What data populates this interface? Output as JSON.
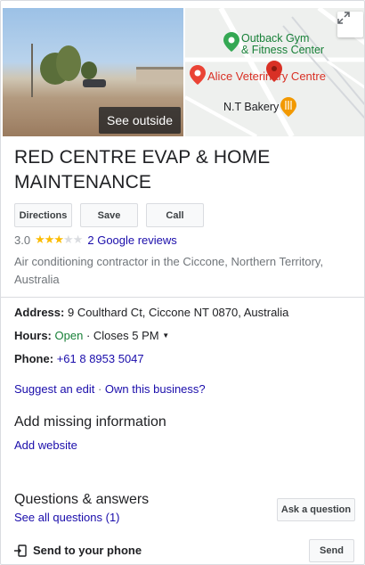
{
  "photo": {
    "see_outside_label": "See outside"
  },
  "map": {
    "labels": {
      "gym": "Outback Gym\n& Fitness Center",
      "vet": "Alice Veterinary Centre",
      "bakery": "N.T Bakery"
    },
    "expand_icon": "expand-icon"
  },
  "business": {
    "name": "RED CENTRE EVAP & HOME MAINTENANCE",
    "rating_value": "3.0",
    "rating_stars": 3,
    "reviews_label": "2 Google reviews",
    "category": "Air conditioning contractor in the Ciccone, Northern Territory, Australia"
  },
  "actions": {
    "directions": "Directions",
    "save": "Save",
    "call": "Call"
  },
  "details": {
    "address_label": "Address:",
    "address_value": "9 Coulthard Ct, Ciccone NT 0870, Australia",
    "hours_label": "Hours:",
    "hours_status": "Open",
    "hours_sep": " · ",
    "hours_closes": "Closes 5 PM",
    "phone_label": "Phone:",
    "phone_value": "+61 8 8953 5047"
  },
  "links": {
    "suggest_edit": "Suggest an edit",
    "sep": " · ",
    "own_business": "Own this business?"
  },
  "missing": {
    "heading": "Add missing information",
    "add_website": "Add website"
  },
  "qa": {
    "heading": "Questions & answers",
    "see_all": "See all questions (1)",
    "ask_button": "Ask a question"
  },
  "send": {
    "label": "Send to your phone",
    "button": "Send"
  },
  "colors": {
    "link": "#1a0dab",
    "open": "#188038",
    "star": "#fbbc04",
    "vet_pin": "#ea4335",
    "gym_pin": "#34a853"
  }
}
